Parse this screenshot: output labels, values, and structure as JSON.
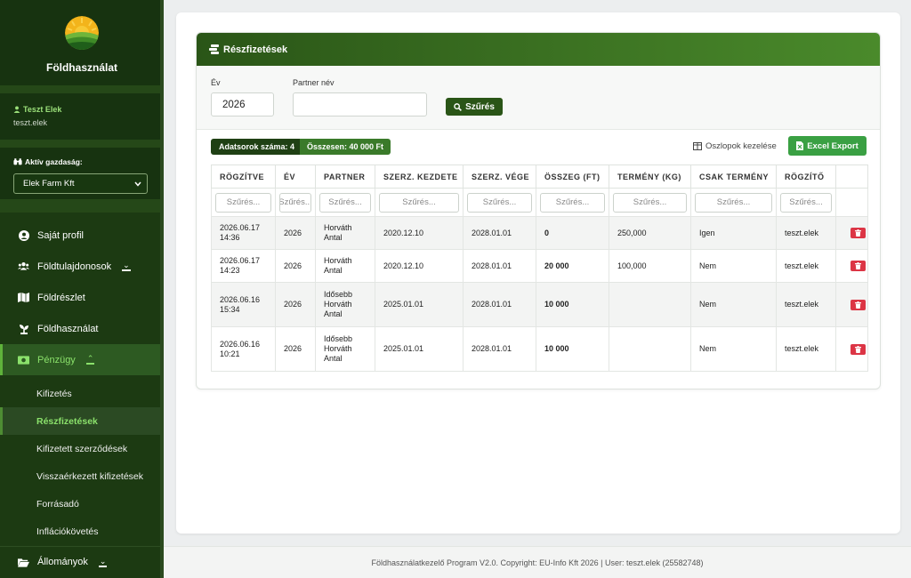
{
  "brand": {
    "title": "Földhasználat",
    "logo_icon": "sun-field-logo"
  },
  "user": {
    "name": "Teszt Elek",
    "login": "teszt.elek"
  },
  "farm": {
    "label": "Aktív gazdaság:",
    "selected": "Elek Farm Kft"
  },
  "menu": {
    "items": [
      {
        "label": "Saját profil",
        "icon": "user-circle-icon"
      },
      {
        "label": "Földtulajdonosok",
        "icon": "users-icon"
      },
      {
        "label": "Földrészlet",
        "icon": "map-icon"
      },
      {
        "label": "Földhasználat",
        "icon": "seedling-icon"
      },
      {
        "label": "Pénzügy",
        "icon": "money-icon"
      }
    ],
    "sub_items": [
      {
        "label": "Kifizetés"
      },
      {
        "label": "Részfizetések"
      },
      {
        "label": "Kifizetett szerződések"
      },
      {
        "label": "Visszaérkezett kifizetések"
      },
      {
        "label": "Forrásadó"
      },
      {
        "label": "Inflációkövetés"
      }
    ],
    "bottom_item": {
      "label": "Állományok",
      "icon": "folder-open-icon"
    }
  },
  "panel": {
    "title": "Részfizetések",
    "filters": {
      "year_label": "Év",
      "year_value": "2026",
      "partner_label": "Partner név",
      "partner_value": "",
      "filter_button": "Szűrés"
    },
    "toolbar": {
      "rows_badge": "Adatsorok száma: 4",
      "total_badge": "Összesen: 40 000 Ft",
      "columns_button": "Oszlopok kezelése",
      "excel_button": "Excel Export"
    },
    "table": {
      "headers": [
        "RÖGZÍTVE",
        "ÉV",
        "PARTNER",
        "SZERZ. KEZDETE",
        "SZERZ. VÉGE",
        "ÖSSZEG (FT)",
        "TERMÉNY (KG)",
        "CSAK TERMÉNY",
        "RÖGZÍTŐ",
        ""
      ],
      "filter_placeholders": [
        "Szűrés...",
        "Szűrés...",
        "Szűrés...",
        "Szűrés...",
        "Szűrés...",
        "Szűrés...",
        "Szűrés...",
        "Szűrés...",
        "Szűrés..."
      ],
      "rows": [
        {
          "recorded_date": "2026.06.17",
          "recorded_time": "14:36",
          "year": "2026",
          "partner": [
            "Horváth",
            "Antal"
          ],
          "start": "2020.12.10",
          "end": "2028.01.01",
          "amount": "0",
          "crop": "250,000",
          "crop_only": "Igen",
          "recorder": "teszt.elek"
        },
        {
          "recorded_date": "2026.06.17",
          "recorded_time": "14:23",
          "year": "2026",
          "partner": [
            "Horváth",
            "Antal"
          ],
          "start": "2020.12.10",
          "end": "2028.01.01",
          "amount": "20 000",
          "crop": "100,000",
          "crop_only": "Nem",
          "recorder": "teszt.elek"
        },
        {
          "recorded_date": "2026.06.16",
          "recorded_time": "15:34",
          "year": "2026",
          "partner": [
            "Idősebb",
            "Horváth",
            "Antal"
          ],
          "start": "2025.01.01",
          "end": "2028.01.01",
          "amount": "10 000",
          "crop": "",
          "crop_only": "Nem",
          "recorder": "teszt.elek"
        },
        {
          "recorded_date": "2026.06.16",
          "recorded_time": "10:21",
          "year": "2026",
          "partner": [
            "Idősebb",
            "Horváth",
            "Antal"
          ],
          "start": "2025.01.01",
          "end": "2028.01.01",
          "amount": "10 000",
          "crop": "",
          "crop_only": "Nem",
          "recorder": "teszt.elek"
        }
      ]
    }
  },
  "footer": {
    "text": "Földhasználatkezelő Program V2.0. Copyright: EU-Info Kft 2026 | User: teszt.elek (25582748)"
  },
  "colors": {
    "sidebar_bg": "#1c3a12",
    "header_green": "#2a5517",
    "accent_green": "#8be16b",
    "excel_green": "#3aa043",
    "delete_red": "#dc3545"
  }
}
